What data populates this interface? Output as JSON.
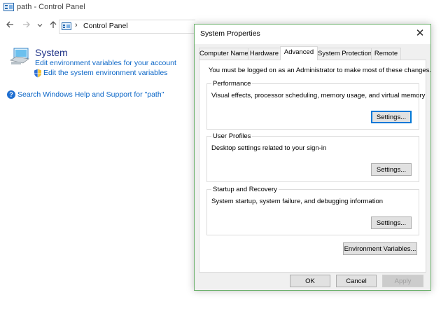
{
  "window": {
    "title": "path - Control Panel"
  },
  "address_bar": {
    "separator": "›",
    "location": "Control Panel"
  },
  "control_panel": {
    "system_heading": "System",
    "links": {
      "env_account": "Edit environment variables for your account",
      "env_system": "Edit the system environment variables",
      "search_help": "Search Windows Help and Support for \"path\""
    }
  },
  "dialog": {
    "title": "System Properties",
    "close_glyph": "✕",
    "tabs": [
      {
        "label": "Computer Name",
        "selected": false
      },
      {
        "label": "Hardware",
        "selected": false
      },
      {
        "label": "Advanced",
        "selected": true
      },
      {
        "label": "System Protection",
        "selected": false
      },
      {
        "label": "Remote",
        "selected": false
      }
    ],
    "admin_note": "You must be logged on as an Administrator to make most of these changes.",
    "groups": {
      "performance": {
        "label": "Performance",
        "description": "Visual effects, processor scheduling, memory usage, and virtual memory",
        "button": "Settings..."
      },
      "user_profiles": {
        "label": "User Profiles",
        "description": "Desktop settings related to your sign-in",
        "button": "Settings..."
      },
      "startup_recovery": {
        "label": "Startup and Recovery",
        "description": "System startup, system failure, and debugging information",
        "button": "Settings..."
      }
    },
    "env_vars_button": "Environment Variables...",
    "buttons": {
      "ok": "OK",
      "cancel": "Cancel",
      "apply": "Apply"
    }
  },
  "icons": {
    "title": "control-panel-icon",
    "address": "control-panel-icon",
    "back": "arrow-left-icon",
    "forward": "arrow-right-icon",
    "recent": "chevron-down-icon",
    "up": "arrow-up-icon",
    "system": "computer-icon",
    "shield": "uac-shield-icon",
    "help": "help-icon"
  },
  "colors": {
    "link": "#0b66c7",
    "heading": "#1e3287",
    "dialog_border": "#6bb06b",
    "focus": "#0078d7"
  }
}
